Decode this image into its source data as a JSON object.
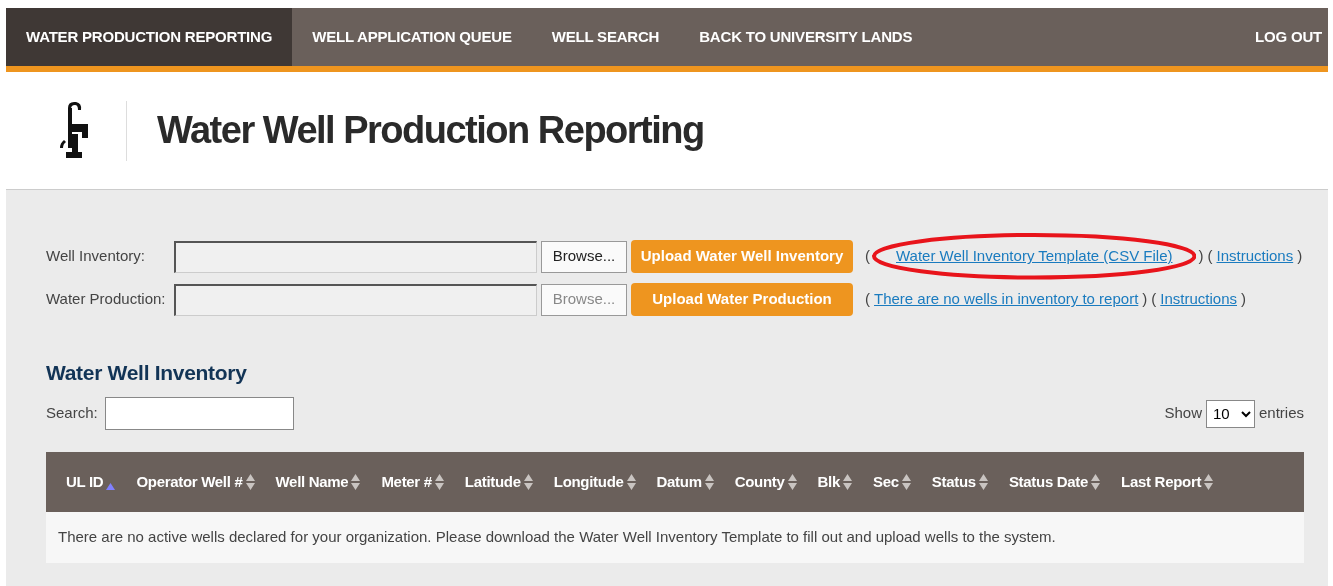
{
  "nav": {
    "items": [
      {
        "label": "WATER PRODUCTION REPORTING",
        "selected": true
      },
      {
        "label": "WELL APPLICATION QUEUE",
        "selected": false
      },
      {
        "label": "WELL SEARCH",
        "selected": false
      },
      {
        "label": "BACK TO UNIVERSITY LANDS",
        "selected": false
      }
    ],
    "logout": "LOG OUT"
  },
  "header": {
    "title": "Water Well Production Reporting"
  },
  "uploads": [
    {
      "label": "Well Inventory:",
      "browse": "Browse...",
      "browse_disabled": false,
      "upload": "Upload Water Well Inventory",
      "links": [
        {
          "text": "Water Well Inventory Template (CSV File)",
          "highlighted": true
        },
        {
          "text": "Instructions",
          "highlighted": false
        }
      ]
    },
    {
      "label": "Water Production:",
      "browse": "Browse...",
      "browse_disabled": true,
      "upload": "Upload Water Production",
      "links": [
        {
          "text": "There are no wells in inventory to report",
          "highlighted": false
        },
        {
          "text": "Instructions",
          "highlighted": false
        }
      ]
    }
  ],
  "paren_open": "(",
  "paren_close": ")",
  "inventory": {
    "title": "Water Well Inventory",
    "search_label": "Search:",
    "show_label": "Show",
    "page_size": "10",
    "entries_label": "entries",
    "columns": [
      {
        "label": "UL ID",
        "sorted": true
      },
      {
        "label": "Operator Well #",
        "sorted": false
      },
      {
        "label": "Well Name",
        "sorted": false
      },
      {
        "label": "Meter #",
        "sorted": false
      },
      {
        "label": "Latitude",
        "sorted": false
      },
      {
        "label": "Longitude",
        "sorted": false
      },
      {
        "label": "Datum",
        "sorted": false
      },
      {
        "label": "County",
        "sorted": false
      },
      {
        "label": "Blk",
        "sorted": false
      },
      {
        "label": "Sec",
        "sorted": false
      },
      {
        "label": "Status",
        "sorted": false
      },
      {
        "label": "Status Date",
        "sorted": false
      },
      {
        "label": "Last Report",
        "sorted": false
      }
    ],
    "empty_message": "There are no active wells declared for your organization. Please download the Water Well Inventory Template to fill out and upload wells to the system."
  }
}
